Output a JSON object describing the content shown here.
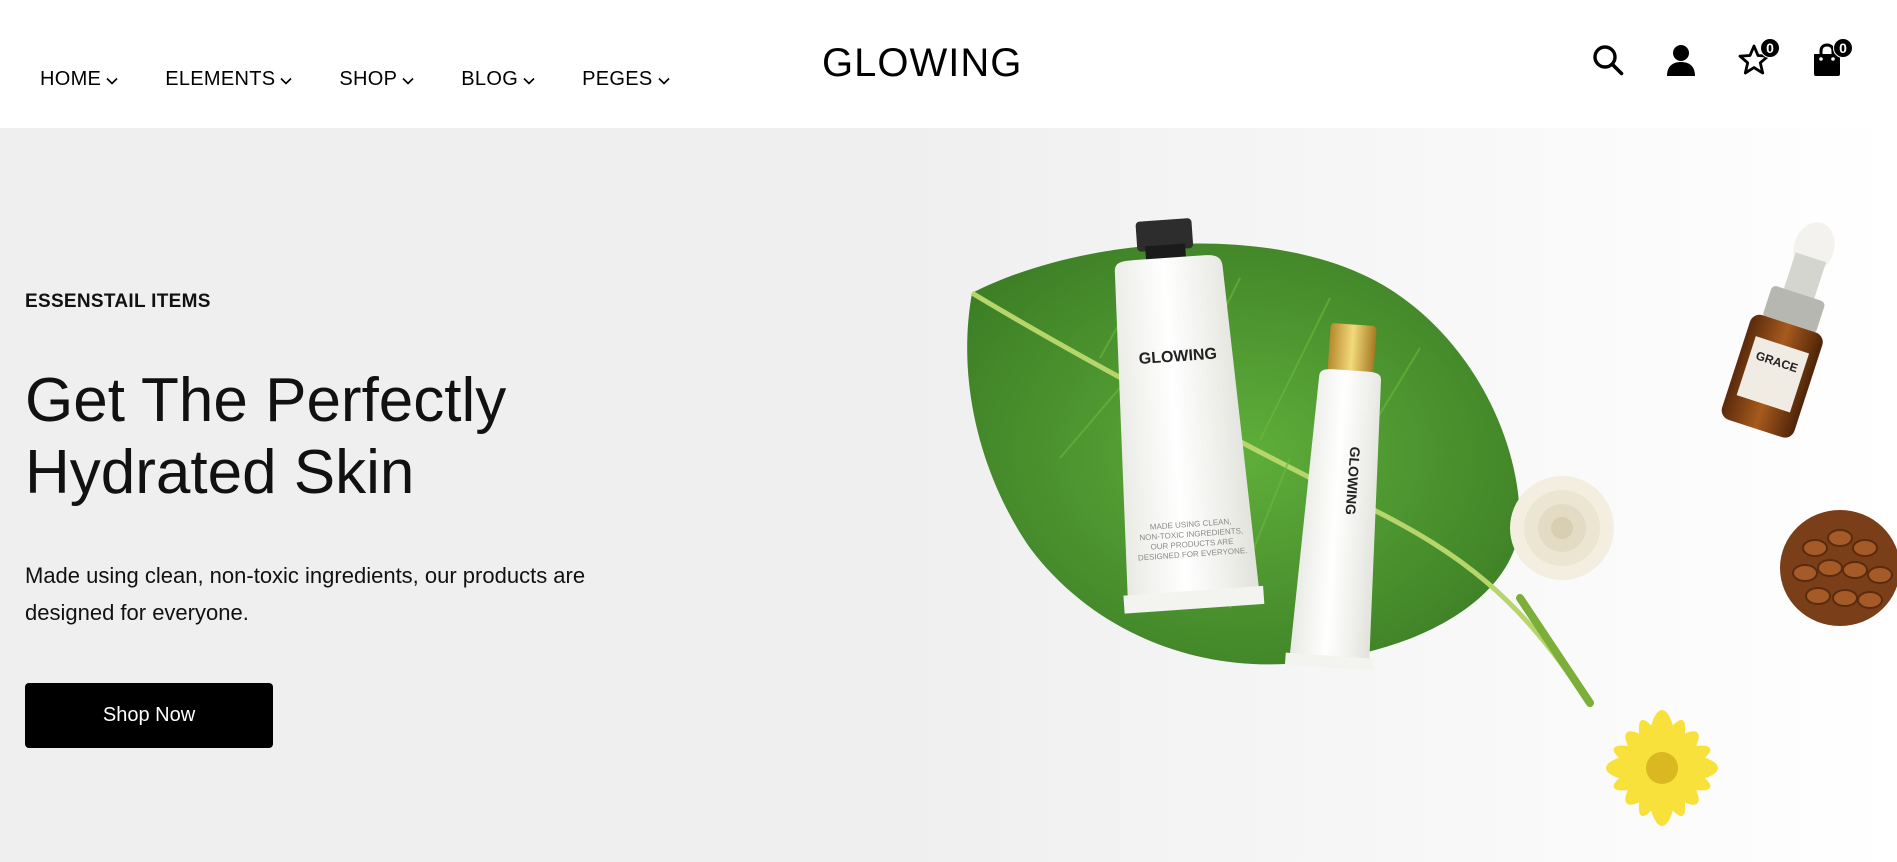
{
  "nav": {
    "items": [
      {
        "label": "HOME"
      },
      {
        "label": "ELEMENTS"
      },
      {
        "label": "SHOP"
      },
      {
        "label": "BLOG"
      },
      {
        "label": "PEGES"
      }
    ]
  },
  "brand": {
    "logo": "GLOWING"
  },
  "header_icons": {
    "search": "search-icon",
    "account": "user-icon",
    "wishlist": "star-icon",
    "cart": "shopping-bag-icon",
    "wishlist_count": "0",
    "cart_count": "0"
  },
  "hero": {
    "eyebrow": "ESSENSTAIL ITEMS",
    "headline_line1": "Get The Perfectly",
    "headline_line2": "Hydrated Skin",
    "description_line1": "Made using clean, non-toxic ingredients, our products are",
    "description_line2": "designed for everyone.",
    "button_label": "Shop Now",
    "image": {
      "tube_large_brand": "GLOWING",
      "tube_large_text": [
        "MADE USING CLEAN,",
        "NON-TOXIC INGREDIENTS,",
        "OUR PRODUCTS ARE",
        "DESIGNED FOR EVERYONE."
      ],
      "tube_small_brand": "GLOWING",
      "bottle_brand": "GRACE"
    }
  },
  "colors": {
    "header_bg": "#ffffff",
    "hero_bg": "#efefef",
    "button_bg": "#000000",
    "button_text": "#ffffff",
    "leaf": "#4f9a32"
  }
}
